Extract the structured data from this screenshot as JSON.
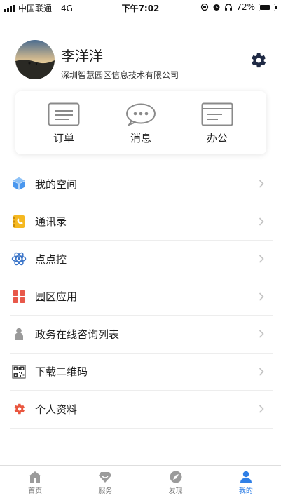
{
  "status_bar": {
    "carrier": "中国联通",
    "network": "4G",
    "time": "下午7:02",
    "battery": "72%",
    "battery_level": 0.72
  },
  "profile": {
    "name": "李洋洋",
    "company": "深圳智慧园区信息技术有限公司"
  },
  "quick_actions": [
    {
      "label": "订单",
      "icon": "order-icon"
    },
    {
      "label": "消息",
      "icon": "message-icon"
    },
    {
      "label": "办公",
      "icon": "office-icon"
    }
  ],
  "menu": [
    {
      "label": "我的空间",
      "icon": "cube-icon",
      "color": "#3a8be8"
    },
    {
      "label": "通讯录",
      "icon": "contacts-icon",
      "color": "#f3b51b"
    },
    {
      "label": "点点控",
      "icon": "atom-icon",
      "color": "#3a74c8"
    },
    {
      "label": "园区应用",
      "icon": "apps-grid-icon",
      "color": "#e8584a"
    },
    {
      "label": "政务在线咨询列表",
      "icon": "person-icon",
      "color": "#9a9a9a"
    },
    {
      "label": "下载二维码",
      "icon": "qrcode-icon",
      "color": "#333333"
    },
    {
      "label": "个人资料",
      "icon": "gear-icon",
      "color": "#e9563f"
    }
  ],
  "tabs": [
    {
      "label": "首页",
      "icon": "home-icon",
      "active": false
    },
    {
      "label": "服务",
      "icon": "diamond-icon",
      "active": false
    },
    {
      "label": "发现",
      "icon": "compass-icon",
      "active": false
    },
    {
      "label": "我的",
      "icon": "user-icon",
      "active": true
    }
  ],
  "colors": {
    "accent": "#2f7fe6",
    "tab_inactive": "#9b9b9b",
    "settings": "#1f2a44"
  }
}
